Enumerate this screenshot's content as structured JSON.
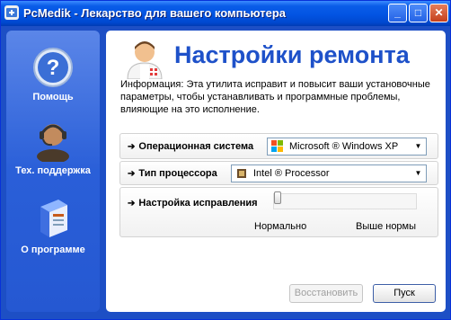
{
  "window": {
    "title": "PcMedik - Лекарство для вашего компьютера"
  },
  "titlebar_buttons": {
    "minimize": "_",
    "maximize": "□",
    "close": "✕"
  },
  "sidebar": {
    "items": [
      {
        "label": "Помощь",
        "icon": "help-icon"
      },
      {
        "label": "Тех. поддержка",
        "icon": "support-headset-icon"
      },
      {
        "label": "О программе",
        "icon": "about-box-icon"
      }
    ]
  },
  "main": {
    "heading": "Настройки ремонта",
    "info": "Информация: Эта утилита исправит и повысит ваши установочные параметры, чтобы устанавливать и программные проблемы, влияющие на это исполнение.",
    "os": {
      "label": "Операционная система",
      "value": "Microsoft ® Windows XP"
    },
    "cpu": {
      "label": "Тип процессора",
      "value": "Intel ® Processor"
    },
    "repair": {
      "label": "Настройка исправления",
      "tick_low": "Нормально",
      "tick_high": "Выше нормы",
      "level": 0
    },
    "restore_button": "Восстановить",
    "start_button": "Пуск"
  },
  "colors": {
    "accent": "#1e51c9",
    "sidebar": "#2a5fd8",
    "titlebar": "#0254e3"
  }
}
